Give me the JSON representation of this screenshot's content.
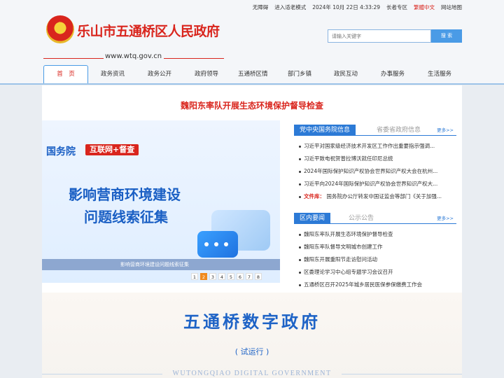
{
  "utility": {
    "accessibility": "无障碍",
    "elder_mode": "进入适老模式",
    "datetime": "2024年 10月 22日 4:33:29",
    "elder_zone": "长者专区",
    "traditional": "繁體中文",
    "sitemap": "网站地图"
  },
  "header": {
    "title": "乐山市五通桥区人民政府",
    "domain": "www.wtq.gov.cn",
    "search_placeholder": "请输入关键字",
    "search_button": "搜 索"
  },
  "nav": {
    "items": [
      "首　页",
      "政务资讯",
      "政务公开",
      "政府领导",
      "五通桥区情",
      "部门乡镇",
      "政民互动",
      "办事服务",
      "生活服务"
    ]
  },
  "headline": "魏阳东率队开展生态环境保护督导检查",
  "banner": {
    "brand_a": "国务院",
    "brand_b": "互联网+督查",
    "line1": "影响营商环境建设",
    "line2": "问题线索征集",
    "caption": "影响营商环境建设问题线索征集",
    "pages": [
      "1",
      "2",
      "3",
      "4",
      "5",
      "6",
      "7",
      "8"
    ],
    "active_page": "2"
  },
  "news1": {
    "tab_active": "党中央国务院信息",
    "tab_inactive": "省委省政府信息",
    "more": "更多>>",
    "items": [
      "习近平对国家级经济技术开发区工作作出重要指示强调...",
      "习近平致电祝贺普拉博沃就任印尼总统",
      "2024年国际保护知识产权协会世界知识产权大会在杭州...",
      "习近平向2024年国际保护知识产权协会世界知识产权大...",
      "国务院办公厅转发中国证监会等部门《关于加强..."
    ],
    "last_prefix": "文件库："
  },
  "news2": {
    "tab_active": "区内要闻",
    "tab_inactive": "公示公告",
    "more": "更多>>",
    "items": [
      "魏阳东率队开展生态环境保护督导检查",
      "魏阳东率队督导文明城市创建工作",
      "魏阳东开展重阳节走访慰问活动",
      "区委理论学习中心组专题学习会议召开",
      "五通桥区召开2025年城乡居民医保参保缴费工作会"
    ]
  },
  "digital": {
    "title": "五通桥数字政府",
    "subtitle": "( 试运行 )",
    "english": "WUTONGQIAO DIGITAL GOVERNMENT"
  }
}
